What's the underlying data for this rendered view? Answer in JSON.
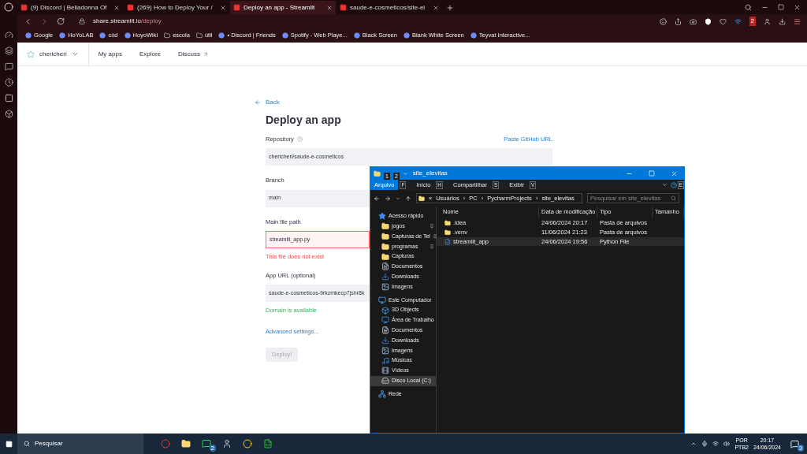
{
  "browser": {
    "tabs": [
      {
        "title": "(9) Discord | Belladonna Of",
        "selected": false
      },
      {
        "title": "(269) How to Deploy Your /",
        "selected": false
      },
      {
        "title": "Deploy an app - Streamlit",
        "selected": true
      },
      {
        "title": "saude-e-cosmeticos/site-el",
        "selected": false
      }
    ],
    "url_host": "share.streamlit.io",
    "url_path": "/deploy",
    "extension_badge": "2",
    "bookmarks": [
      "Google",
      "HoYoLAB",
      "cód",
      "HoyoWiki",
      "escola",
      "útil",
      "• Discord | Friends",
      "Spotify - Web Playe...",
      "Black Screen",
      "Blank White Screen",
      "Teyvat Interactive..."
    ]
  },
  "page": {
    "workspace": "chericheri",
    "nav": [
      "My apps",
      "Explore",
      "Discuss"
    ],
    "back": "Back",
    "title": "Deploy an app",
    "fields": [
      {
        "label": "Repository",
        "help": true,
        "link": "Paste GitHub URL",
        "value": "chericheri/saude-e-cosmeticos",
        "invalid": false
      },
      {
        "label": "Branch",
        "value": "main",
        "invalid": false
      },
      {
        "label": "Main file path",
        "value": "streamlit_app.py",
        "invalid": true,
        "message": {
          "text": "This file does not exist",
          "error": true
        }
      },
      {
        "label": "App URL (optional)",
        "value": "saude-e-cosmeticos-9rkzmkecp7jshr8k",
        "invalid": false,
        "message": {
          "text": "Domain is available",
          "error": false
        }
      }
    ],
    "advanced": "Advanced settings...",
    "deploy": {
      "label": "Deploy!",
      "disabled": true
    }
  },
  "explorer": {
    "title": "site_elevitas",
    "qat_keys": [
      "1",
      "2"
    ],
    "help_key": "E",
    "ribbon_tabs": [
      {
        "label": "Arquivo",
        "key": "F",
        "selected": true
      },
      {
        "label": "Início",
        "key": "H",
        "selected": false
      },
      {
        "label": "Compartilhar",
        "key": "S",
        "selected": false
      },
      {
        "label": "Exibir",
        "key": "V",
        "selected": false
      }
    ],
    "overflow": "«",
    "separator": "›",
    "breadcrumb": [
      "Usuários",
      "PC",
      "PycharmProjects",
      "site_elevitas"
    ],
    "search_placeholder": "Pesquisar em site_elevitas",
    "columns": [
      "Nome",
      "Data de modificação",
      "Tipo",
      "Tamanho"
    ],
    "files": [
      {
        "name": ".idea",
        "modified": "24/06/2024 20:17",
        "type": "Pasta de arquivos",
        "kind": "folder",
        "selected": false
      },
      {
        "name": ".venv",
        "modified": "11/06/2024 21:23",
        "type": "Pasta de arquivos",
        "kind": "folder",
        "selected": false
      },
      {
        "name": "streamlit_app",
        "modified": "24/06/2024 19:56",
        "type": "Python File",
        "kind": "python",
        "selected": true
      }
    ],
    "tree": [
      {
        "label": "Acesso rápido",
        "kind": "star",
        "selected": false,
        "children": [
          {
            "label": "jogos",
            "kind": "folder",
            "pinned": true,
            "selected": false
          },
          {
            "label": "Capturas de Tel",
            "kind": "folder",
            "pinned": true,
            "selected": false
          },
          {
            "label": "programas",
            "kind": "folder",
            "pinned": true,
            "selected": false
          },
          {
            "label": "Capturas",
            "kind": "folder",
            "pinned": false,
            "selected": false
          },
          {
            "label": "Documentos",
            "kind": "documents",
            "pinned": false,
            "selected": false
          },
          {
            "label": "Downloads",
            "kind": "downloads",
            "pinned": false,
            "selected": false
          },
          {
            "label": "Imagens",
            "kind": "pictures",
            "pinned": false,
            "selected": false
          }
        ]
      },
      {
        "label": "Este Computador",
        "kind": "computer",
        "selected": false,
        "children": [
          {
            "label": "3D Objects",
            "kind": "cube",
            "selected": false
          },
          {
            "label": "Área de Trabalho",
            "kind": "desktop",
            "selected": false
          },
          {
            "label": "Documentos",
            "kind": "documents",
            "selected": false
          },
          {
            "label": "Downloads",
            "kind": "downloads",
            "selected": false
          },
          {
            "label": "Imagens",
            "kind": "pictures",
            "selected": false
          },
          {
            "label": "Músicas",
            "kind": "music",
            "selected": false
          },
          {
            "label": "Vídeos",
            "kind": "videos",
            "selected": false
          },
          {
            "label": "Disco Local (C:)",
            "kind": "drive",
            "selected": true
          }
        ]
      },
      {
        "label": "Rede",
        "kind": "network",
        "selected": false
      }
    ]
  },
  "taskbar": {
    "search": "Pesquisar",
    "whatsapp_badge": "2",
    "lang": [
      "POR",
      "PTB2"
    ],
    "time": "20:17",
    "date": "24/06/2024",
    "notifications": "3"
  }
}
